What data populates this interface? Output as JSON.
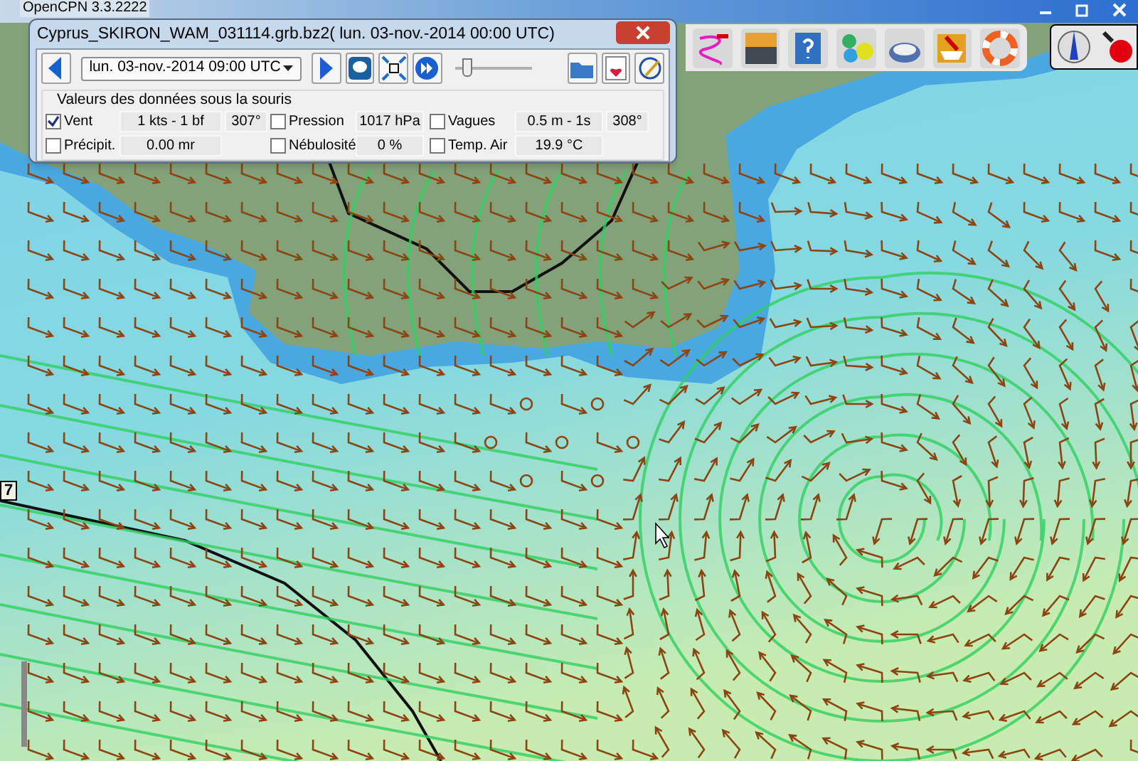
{
  "app_window": {
    "title": "OpenCPN 3.3.2222"
  },
  "grib_dialog": {
    "title": "Cyprus_SKIRON_WAM_031114.grb.bz2( lun. 03-nov.-2014 00:00  UTC)",
    "time_select": {
      "value": "lun. 03-nov.-2014 09:00  UTC"
    },
    "time_slider": {
      "level": 0.1
    },
    "data_group": {
      "title": "Valeurs des données sous la souris",
      "rows": [
        [
          {
            "label": "Vent",
            "checked": true,
            "value": "1 kts -  1 bf",
            "direction": "307°"
          },
          {
            "label": "Pression",
            "checked": false,
            "value": "1017 hPa"
          },
          {
            "label": "Vagues",
            "checked": false,
            "value": "0.5 m - 1s",
            "direction": "308°"
          }
        ],
        [
          {
            "label": "Précipit.",
            "checked": false,
            "value": "0.00 mr"
          },
          {
            "label": "Nébulosité",
            "checked": false,
            "value": "0 %"
          },
          {
            "label": "Temp. Air",
            "checked": false,
            "value": "19.9 °C"
          }
        ]
      ]
    }
  },
  "chart": {
    "edge_label": "7"
  }
}
